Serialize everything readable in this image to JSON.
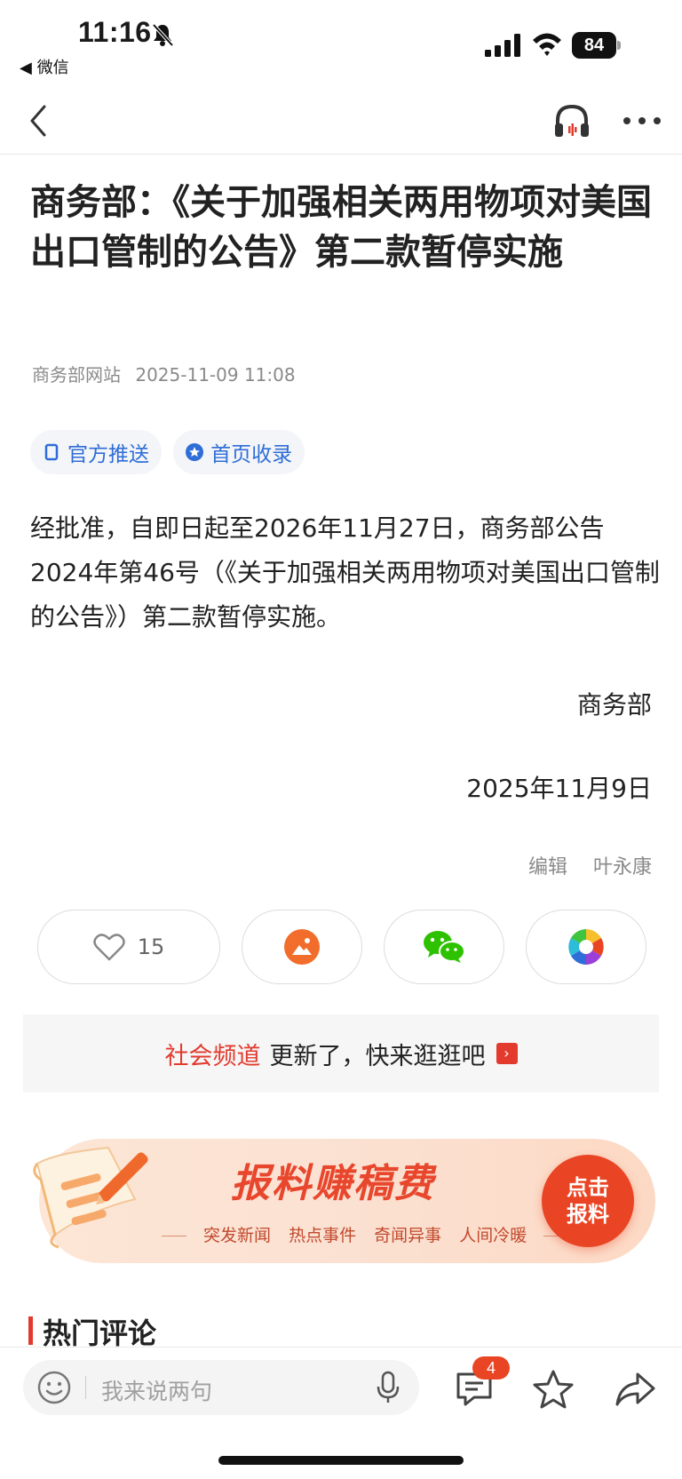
{
  "status_bar": {
    "time": "11:16",
    "back_app": "◀ 微信",
    "battery": "84"
  },
  "article": {
    "title": "商务部：《关于加强相关两用物项对美国出口管制的公告》第二款暂停实施",
    "source": "商务部网站",
    "datetime": "2025-11-09 11:08",
    "tags": [
      "官方推送",
      "首页收录"
    ],
    "body": "经批准，自即日起至2026年11月27日，商务部公告2024年第46号（《关于加强相关两用物项对美国出口管制的公告》）第二款暂停实施。",
    "signature": "商务部",
    "date": "2025年11月9日",
    "editor_label": "编辑",
    "editor_name": "叶永康"
  },
  "actions": {
    "like_count": "15"
  },
  "channel": {
    "name": "社会频道",
    "text": "更新了，快来逛逛吧",
    "arrow": "›"
  },
  "report": {
    "title": "报料赚稿费",
    "subs": [
      "突发新闻",
      "热点事件",
      "奇闻异事",
      "人间冷暖"
    ],
    "button_line1": "点击",
    "button_line2": "报料"
  },
  "hot_comments": {
    "title": "热门评论"
  },
  "bottom_bar": {
    "placeholder": "我来说两句",
    "comment_count": "4"
  },
  "colors": {
    "accent_red": "#e23b2e",
    "link_blue": "#2f6dd8",
    "report_orange": "#e94524"
  }
}
